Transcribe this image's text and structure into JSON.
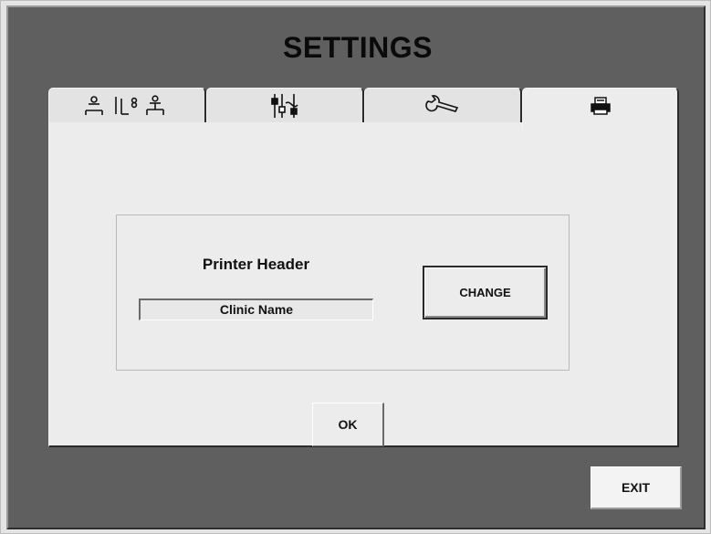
{
  "window": {
    "title": "SETTINGS"
  },
  "tabs": [
    {
      "icon": "patient-bed-icons",
      "active": false
    },
    {
      "icon": "adjustment-controls-icon",
      "active": false
    },
    {
      "icon": "wrench-icon",
      "active": false
    },
    {
      "icon": "printer-icon",
      "active": true
    }
  ],
  "printer_panel": {
    "header_label": "Printer Header",
    "clinic_name_value": "Clinic Name",
    "change_label": "CHANGE"
  },
  "footer": {
    "ok_label": "OK",
    "exit_label": "EXIT"
  },
  "colors": {
    "window_bg": "#5f5f5f",
    "panel_bg": "#ececec",
    "text": "#111111"
  }
}
